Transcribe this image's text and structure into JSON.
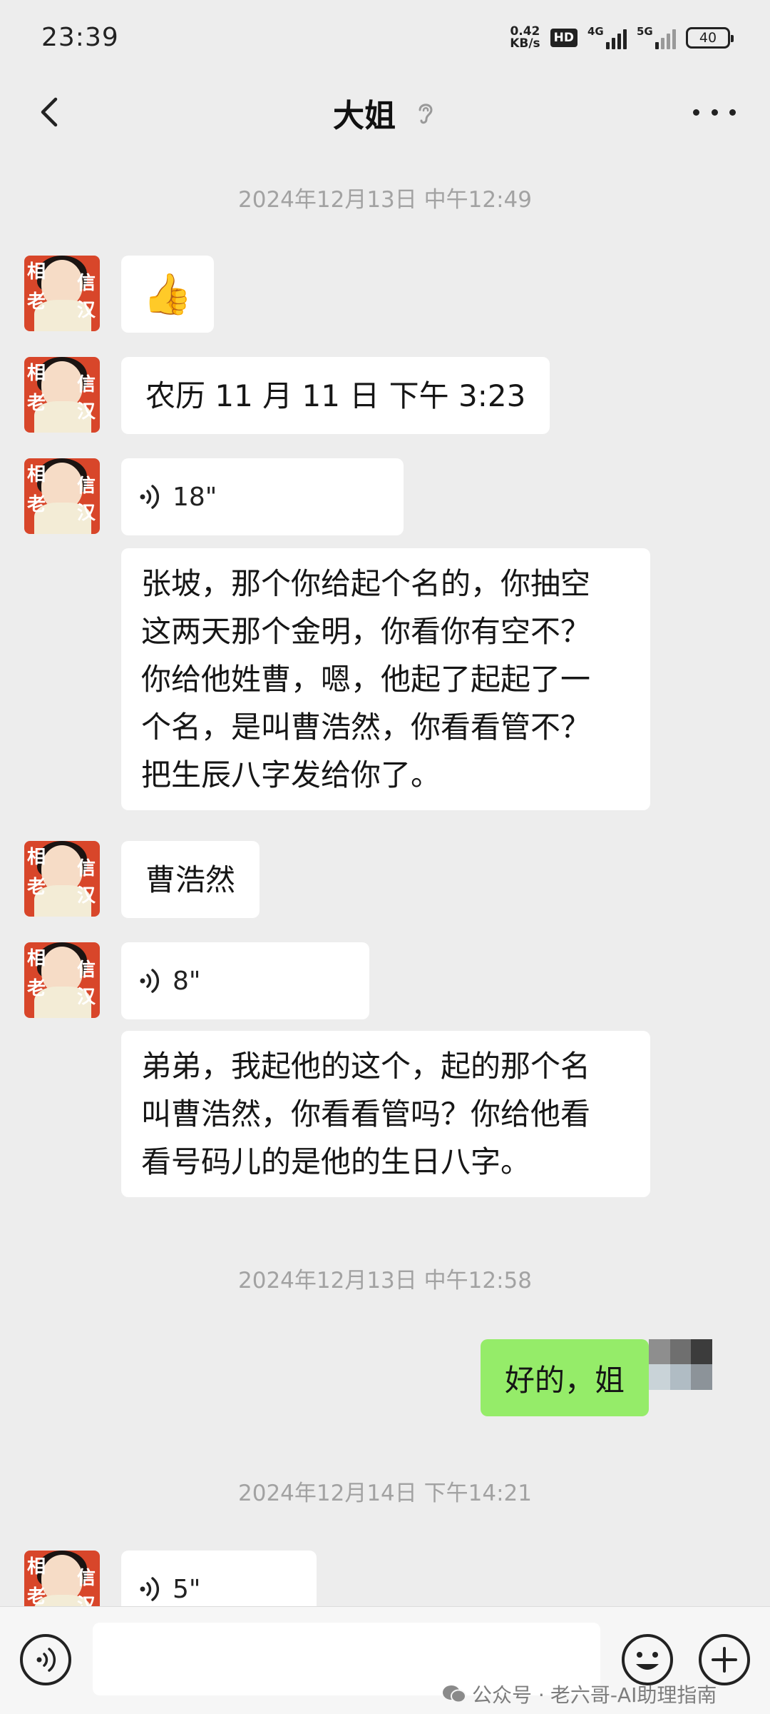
{
  "status_bar": {
    "time": "23:39",
    "net_speed_value": "0.42",
    "net_speed_unit": "KB/s",
    "hd_badge": "HD",
    "network_1": "4G",
    "network_2": "5G",
    "battery": "40"
  },
  "header": {
    "title": "大姐",
    "back_icon": "chevron-left-icon",
    "ear_icon": "ear-icon",
    "more_icon": "more-dots-icon"
  },
  "messages": {
    "timestamp_1": "2024年12月13日 中午12:49",
    "avatar_text": [
      "相",
      "信",
      "老",
      "汉"
    ],
    "msg_thumb_emoji": "👍",
    "msg_lunar": "农历 11 月 11 日  下午 3:23",
    "voice_1_duration": "18\"",
    "transcript_1": [
      "张坡，那个你给起个名的，你抽空",
      "这两天那个金明，你看你有空不？",
      "你给他姓曹，嗯，他起了起起了一",
      "个名，是叫曹浩然，你看看管不？",
      "把生辰八字发给你了。"
    ],
    "msg_name": "曹浩然",
    "voice_2_duration": "8\"",
    "transcript_2": [
      "弟弟，我起他的这个，起的那个名",
      "叫曹浩然，你看看管吗？你给他看",
      "看号码儿的是他的生日八字。"
    ],
    "timestamp_2": "2024年12月13日 中午12:58",
    "msg_reply": "好的，姐",
    "timestamp_3": "2024年12月14日 下午14:21",
    "voice_3_duration": "5\""
  },
  "input_bar": {
    "voice_icon": "voice-input-icon",
    "emoji_icon": "smiley-icon",
    "plus_icon": "plus-icon",
    "watermark_prefix": "公众号 · ",
    "watermark_author": "老六哥-AI助理指南"
  },
  "colors": {
    "background": "#ededed",
    "bubble_in": "#ffffff",
    "bubble_out": "#95ec69",
    "timestamp": "#a2a2a2"
  }
}
